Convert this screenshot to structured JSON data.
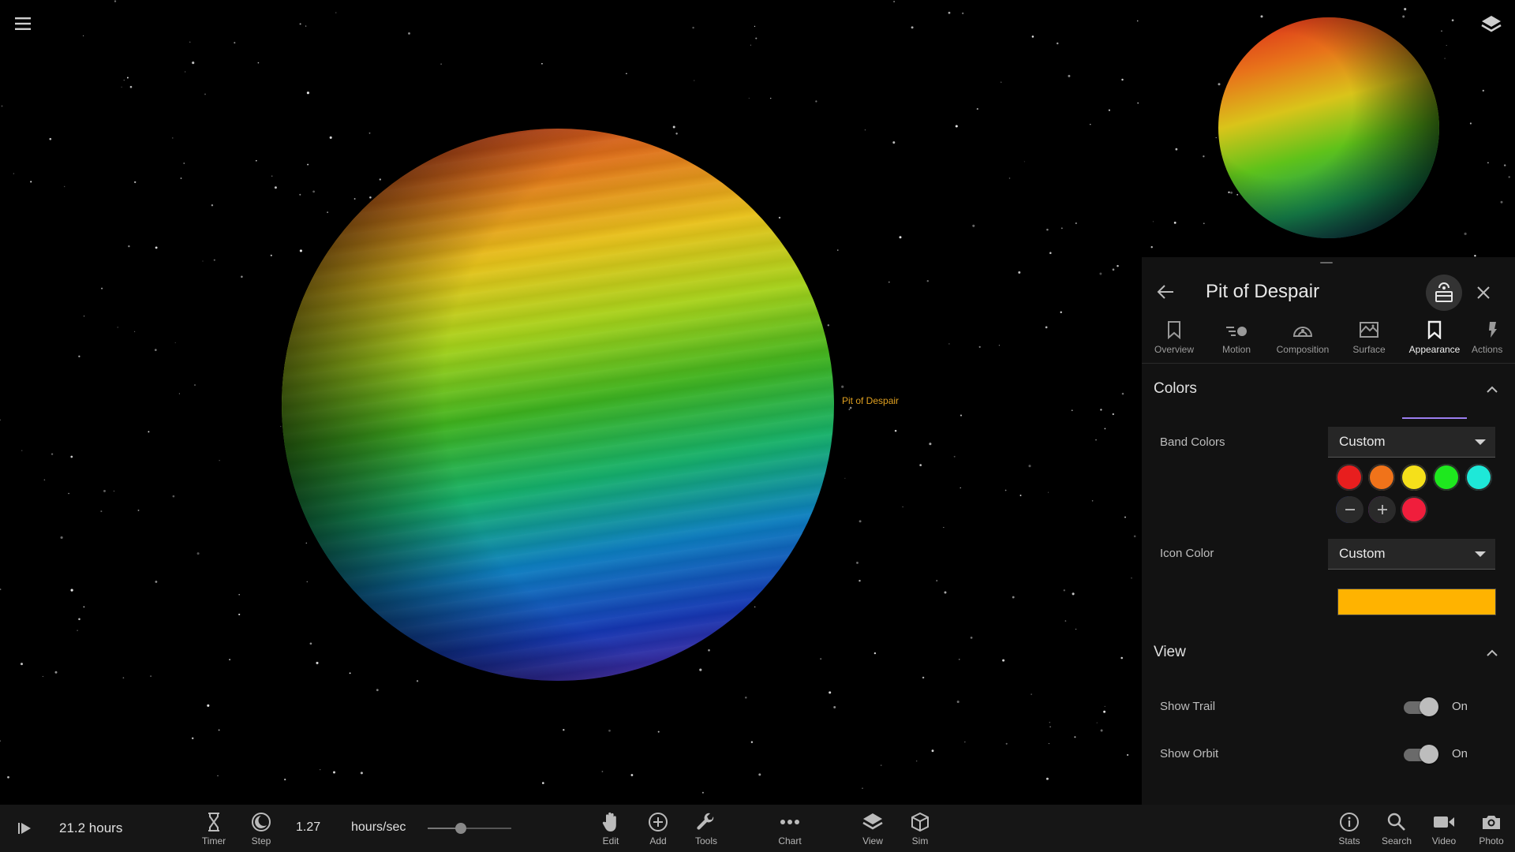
{
  "scene": {
    "planet_label": "Pit of Despair"
  },
  "panel": {
    "title": "Pit of Despair",
    "tabs": [
      {
        "label": "Overview",
        "icon": "bookmark-outline-icon"
      },
      {
        "label": "Motion",
        "icon": "motion-icon"
      },
      {
        "label": "Composition",
        "icon": "composition-icon"
      },
      {
        "label": "Surface",
        "icon": "surface-map-icon"
      },
      {
        "label": "Appearance",
        "icon": "bookmark-icon",
        "active": true
      },
      {
        "label": "Actions",
        "icon": "actions-icon"
      }
    ],
    "colors_section": {
      "title": "Colors",
      "band_colors_label": "Band Colors",
      "band_colors_value": "Custom",
      "band_swatches": [
        "#e81e1e",
        "#f0731a",
        "#f5e01a",
        "#1ee81e",
        "#1ee8d8",
        "#1e3ef0",
        "#c81ef0",
        "#f01e3c"
      ],
      "icon_color_label": "Icon Color",
      "icon_color_value": "Custom",
      "icon_color": "#ffb300"
    },
    "view_section": {
      "title": "View",
      "show_trail_label": "Show Trail",
      "show_trail_state": "On",
      "show_orbit_label": "Show Orbit",
      "show_orbit_state": "On"
    }
  },
  "bottombar": {
    "time": "21.2 hours",
    "rate": "1.27",
    "rate_unit": "hours/sec",
    "rate_slider_fraction": 0.4,
    "timer_label": "Timer",
    "step_label": "Step",
    "edit_label": "Edit",
    "add_label": "Add",
    "tools_label": "Tools",
    "chart_label": "Chart",
    "view_label": "View",
    "sim_label": "Sim",
    "stats_label": "Stats",
    "search_label": "Search",
    "video_label": "Video",
    "photo_label": "Photo"
  }
}
